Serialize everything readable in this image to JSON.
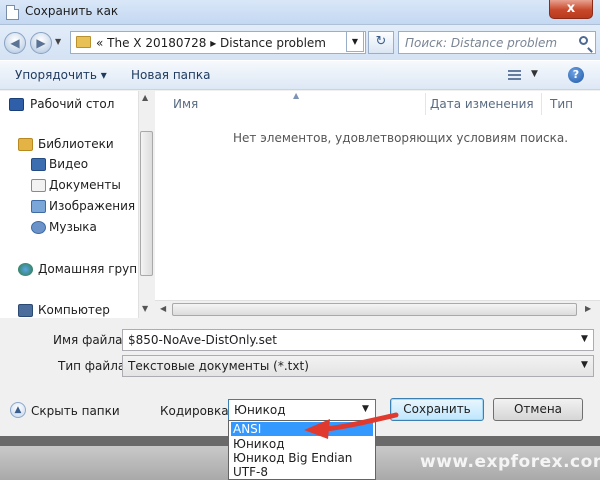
{
  "window": {
    "title": "Сохранить как",
    "close_symbol": "x"
  },
  "nav": {
    "back_symbol": "◀",
    "forward_symbol": "▶",
    "address_path": "«  The X 20180728  ▸  Distance problem",
    "refresh_symbol": "↻",
    "search_placeholder": "Поиск: Distance problem"
  },
  "toolbar": {
    "organize_label": "Упорядочить ▾",
    "new_folder_label": "Новая папка",
    "help_symbol": "?"
  },
  "navpane": {
    "items": [
      {
        "label": "Рабочий стол",
        "icon": "desktop-icon"
      },
      {
        "label": "Библиотеки",
        "icon": "libraries-icon"
      },
      {
        "label": "Видео",
        "icon": "video-icon"
      },
      {
        "label": "Документы",
        "icon": "documents-icon"
      },
      {
        "label": "Изображения",
        "icon": "images-icon"
      },
      {
        "label": "Музыка",
        "icon": "music-icon"
      },
      {
        "label": "Домашняя группа",
        "icon": "homegroup-icon"
      },
      {
        "label": "Компьютер",
        "icon": "computer-icon"
      }
    ]
  },
  "filelist": {
    "columns": [
      "Имя",
      "Дата изменения",
      "Тип"
    ],
    "empty_message": "Нет элементов, удовлетворяющих условиям поиска."
  },
  "form": {
    "filename_label": "Имя файла:",
    "filename_value": "$850-NoAve-DistOnly.set",
    "savetype_label": "Тип файла:",
    "savetype_value": "Текстовые документы (*.txt)",
    "encoding_label": "Кодировка:",
    "encoding_value": "Юникод",
    "encoding_options": [
      "ANSI",
      "Юникод",
      "Юникод Big Endian",
      "UTF-8"
    ],
    "selected_option": "ANSI"
  },
  "buttons": {
    "hide_folders": "Скрыть папки",
    "save": "Сохранить",
    "cancel": "Отмена"
  },
  "watermark": "www.expforex.com",
  "colors": {
    "selection": "#3399ff",
    "arrow": "#e03a2e",
    "close_button": "#c8482b"
  }
}
